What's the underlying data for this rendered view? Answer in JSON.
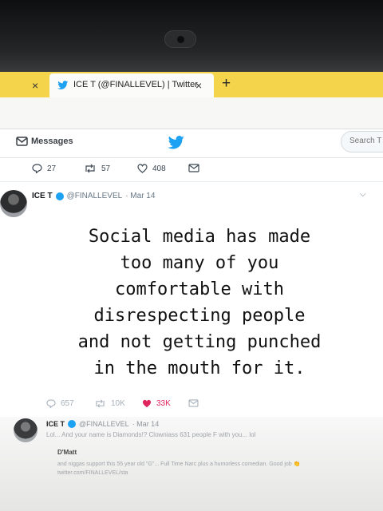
{
  "browser": {
    "prev_tab_close": "×",
    "active_tab": {
      "title": "ICE T (@FINALLEVEL) | Twitter",
      "close": "×"
    },
    "new_tab": "+"
  },
  "nav": {
    "messages_label": "Messages",
    "search_placeholder": "Search T"
  },
  "previous_tweet_actions": {
    "replies": "27",
    "retweets": "57",
    "likes": "408"
  },
  "tweet": {
    "author_name": "ICE T",
    "handle": "@FINALLEVEL",
    "date": "· Mar 14",
    "text_lines": [
      "Social media has made",
      "too many of you",
      "comfortable with",
      "disrespecting people",
      "and not getting punched",
      "in the mouth for it."
    ],
    "actions": {
      "replies": "657",
      "retweets": "10K",
      "likes": "33K"
    }
  },
  "reply": {
    "author_name": "ICE T",
    "handle": "@FINALLEVEL",
    "date": "· Mar 14",
    "text": "Lol... And your name is Diamonds!?   Clowniass 631 people F with you... lol",
    "quoted_name": "D'Matt",
    "quoted_text": "and niggas support this 55 year old \"G\"... Full Time Narc plus a humorless comedian. Good job 👏 twitter.com/FINALLEVEL/sta"
  },
  "colors": {
    "tab_strip": "#f4d44a",
    "twitter_blue": "#1da1f2",
    "like_red": "#e0245e"
  }
}
